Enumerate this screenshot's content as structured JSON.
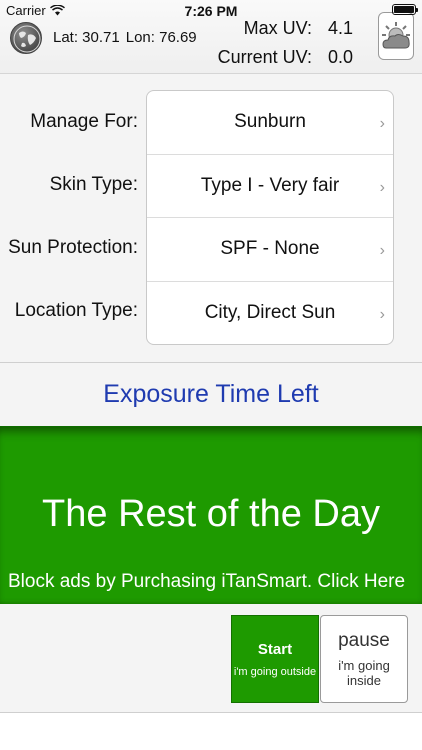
{
  "status_bar": {
    "carrier": "Carrier",
    "time": "7:26 PM",
    "icons": [
      "wifi-icon",
      "battery-icon"
    ]
  },
  "header": {
    "location_label": "Lat: 30.71",
    "longitude_label": "Lon: 76.69",
    "max_uv_label": "Max UV:",
    "max_uv_value": "4.1",
    "current_uv_label": "Current UV:",
    "current_uv_value": "0.0",
    "icons": [
      "globe-icon",
      "weather-icon"
    ]
  },
  "settings": {
    "rows": [
      {
        "label": "Manage For:",
        "value": "Sunburn"
      },
      {
        "label": "Skin Type:",
        "value": "Type I - Very fair"
      },
      {
        "label": "Sun Protection:",
        "value": "SPF - None"
      },
      {
        "label": "Location Type:",
        "value": "City, Direct Sun"
      }
    ]
  },
  "exposure": {
    "title": "Exposure Time Left",
    "value": "The Rest of the Day",
    "ad_text": "Block ads by Purchasing iTanSmart. Click Here"
  },
  "actions": {
    "start_label": "Start",
    "start_sub": "i'm going outside",
    "pause_label": "pause",
    "pause_sub": "i'm going inside"
  },
  "colors": {
    "accent_green": "#1e9a00",
    "title_blue": "#1f3bb0"
  }
}
